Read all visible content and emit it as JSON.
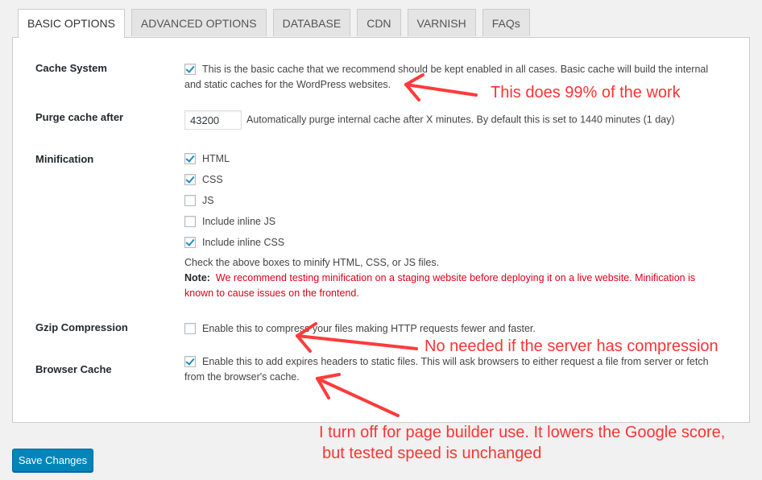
{
  "tabs": [
    {
      "label": "BASIC OPTIONS",
      "active": true
    },
    {
      "label": "ADVANCED OPTIONS",
      "active": false
    },
    {
      "label": "DATABASE",
      "active": false
    },
    {
      "label": "CDN",
      "active": false
    },
    {
      "label": "VARNISH",
      "active": false
    },
    {
      "label": "FAQs",
      "active": false
    }
  ],
  "settings": {
    "cache_system": {
      "label": "Cache System",
      "checked": true,
      "description_line1": "This is the basic cache that we recommend should be kept enabled in all cases. Basic cache will build the internal",
      "description_line2": "and static caches for the WordPress websites."
    },
    "purge_cache": {
      "label": "Purge cache after",
      "value": "43200",
      "description": "Automatically purge internal cache after X minutes. By default this is set to 1440 minutes (1 day)"
    },
    "minification": {
      "label": "Minification",
      "options": [
        {
          "label": "HTML",
          "checked": true
        },
        {
          "label": "CSS",
          "checked": true
        },
        {
          "label": "JS",
          "checked": false
        },
        {
          "label": "Include inline JS",
          "checked": false
        },
        {
          "label": "Include inline CSS",
          "checked": true
        }
      ],
      "help": "Check the above boxes to minify HTML, CSS, or JS files.",
      "note_label": "Note:",
      "note_line1": "We recommend testing minification on a staging website before deploying it on a live website. Minification is",
      "note_line2": "known to cause issues on the frontend."
    },
    "gzip": {
      "label": "Gzip Compression",
      "checked": false,
      "description": "Enable this to compress your files making HTTP requests fewer and faster."
    },
    "browser_cache": {
      "label": "Browser Cache",
      "checked": true,
      "description_line1": "Enable this to add expires headers to static files. This will ask browsers to either request a file from server or fetch",
      "description_line2": "from the browser's cache."
    }
  },
  "save_button": "Save Changes",
  "annotations": {
    "cache_note": "This does 99% of the work",
    "gzip_note": "No needed if the server has compression",
    "browser_note_line1": "I turn off for page builder use. It lowers the Google score,",
    "browser_note_line2": "but tested speed is unchanged",
    "color": "#ff3b3b"
  },
  "colors": {
    "primary_button": "#0085ba",
    "checkmark": "#1e8cbe",
    "note_text": "#e0001b"
  }
}
